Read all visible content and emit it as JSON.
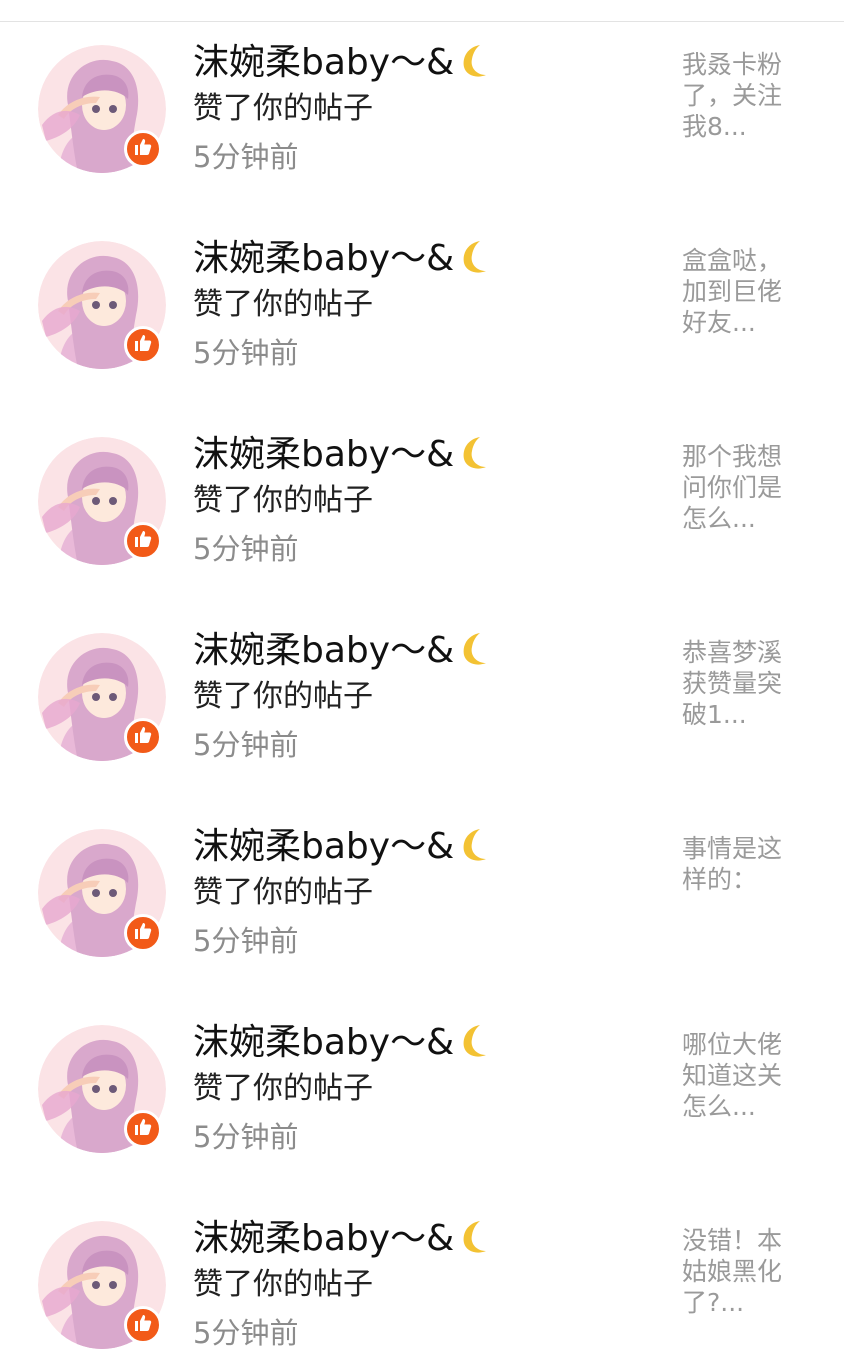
{
  "colors": {
    "badge": "#f25a18",
    "name_text": "#111111",
    "time_text": "#8c8c8c",
    "preview_text": "#9a9a9a"
  },
  "icons": {
    "badge": "thumbs-up-icon",
    "moon": "crescent-moon-icon"
  },
  "notifications": [
    {
      "name": "沫婉柔baby～&",
      "action": "赞了你的帖子",
      "time": "5分钟前",
      "preview": "我叒卡粉了，关注我8..."
    },
    {
      "name": "沫婉柔baby～&",
      "action": "赞了你的帖子",
      "time": "5分钟前",
      "preview": "盒盒哒，加到巨佬好友..."
    },
    {
      "name": "沫婉柔baby～&",
      "action": "赞了你的帖子",
      "time": "5分钟前",
      "preview": "那个我想问你们是怎么..."
    },
    {
      "name": "沫婉柔baby～&",
      "action": "赞了你的帖子",
      "time": "5分钟前",
      "preview": "恭喜梦溪获赞量突破1..."
    },
    {
      "name": "沫婉柔baby～&",
      "action": "赞了你的帖子",
      "time": "5分钟前",
      "preview": "事情是这样的："
    },
    {
      "name": "沫婉柔baby～&",
      "action": "赞了你的帖子",
      "time": "5分钟前",
      "preview": "哪位大佬知道这关怎么..."
    },
    {
      "name": "沫婉柔baby～&",
      "action": "赞了你的帖子",
      "time": "5分钟前",
      "preview": "没错！本姑娘黑化了?..."
    }
  ]
}
